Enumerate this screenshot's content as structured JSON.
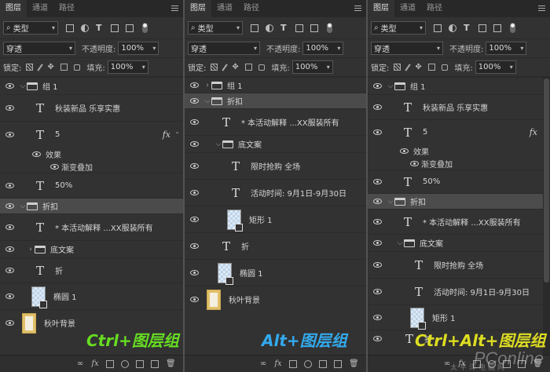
{
  "tabs": [
    "图层",
    "通道",
    "路径"
  ],
  "filter": {
    "kind": "类型"
  },
  "blend_mode": "穿透",
  "opacity_label": "不透明度:",
  "opacity_value": "100%",
  "lock_label": "锁定:",
  "fill_label": "填充:",
  "fill_value": "100%",
  "panel1": {
    "caption": "Ctrl+图层组",
    "caption_color": "#66dd22",
    "layers": [
      "组 1",
      "秋装新品 乐享实惠",
      "5",
      "效果",
      "渐变叠加",
      "50%",
      "折扣",
      "* 本活动解释 ...XX服装所有",
      "底文案",
      "折",
      "椭圆 1",
      "秋叶背景"
    ]
  },
  "panel2": {
    "caption": "Alt+图层组",
    "caption_color": "#33aaee",
    "layers": [
      "组 1",
      "折扣",
      "* 本活动解释 ...XX服装所有",
      "底文案",
      "限时抢购 全场",
      "活动时间: 9月1日-9月30日",
      "矩形 1",
      "折",
      "椭圆 1",
      "秋叶背景"
    ]
  },
  "panel3": {
    "caption": "Ctrl+Alt+图层组",
    "caption_color": "#dddd22",
    "layers": [
      "组 1",
      "秋装新品 乐享实惠",
      "5",
      "效果",
      "渐变叠加",
      "50%",
      "折扣",
      "* 本活动解释 ...XX服装所有",
      "底文案",
      "限时抢购 全场",
      "活动时间: 9月1日-9月30日",
      "矩形 1",
      "折"
    ]
  },
  "watermark": "PConline",
  "watermark_sub": "太平洋电脑网",
  "icons": [
    "eye-icon",
    "folder-icon",
    "text-layer-icon",
    "fx-icon",
    "link-icon",
    "mask-icon",
    "adjustment-icon",
    "new-group-icon",
    "new-layer-icon",
    "trash-icon"
  ]
}
